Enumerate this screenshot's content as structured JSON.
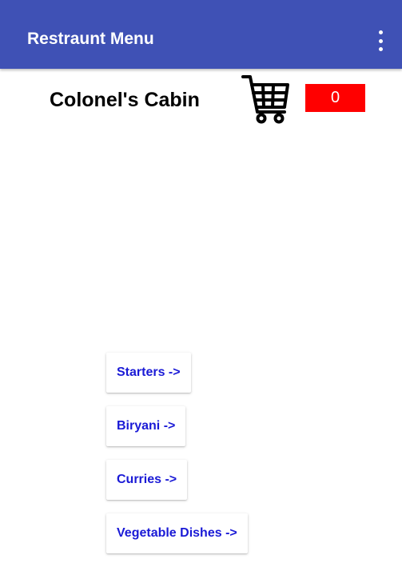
{
  "app_bar": {
    "title": "Restraunt Menu",
    "overflow_icon": "more-vert-icon",
    "background_color": "#3f51b5"
  },
  "header": {
    "restaurant_name": "Colonel's Cabin",
    "cart_icon": "shopping-cart-icon",
    "cart_count": "0",
    "cart_count_color": "#ff0000"
  },
  "menu": {
    "categories": [
      {
        "label": "Starters ->"
      },
      {
        "label": "Biryani ->"
      },
      {
        "label": "Curries ->"
      },
      {
        "label": "Vegetable Dishes ->"
      }
    ],
    "label_color": "#1a1ad6"
  }
}
